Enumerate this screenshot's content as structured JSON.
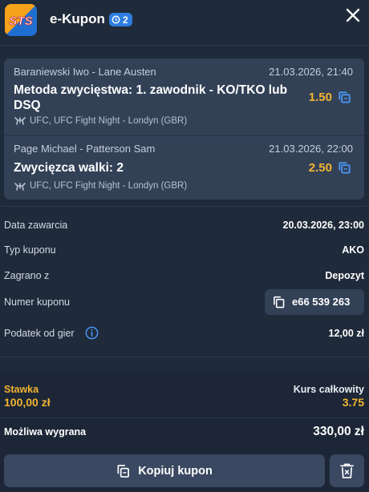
{
  "header": {
    "logo_text": "STS",
    "title": "e-Kupon",
    "badge_count": "2"
  },
  "bets": [
    {
      "match": "Baraniewski Iwo - Lane Austen",
      "date": "21.03.2026, 21:40",
      "market": "Metoda zwycięstwa: 1. zawodnik - KO/TKO lub DSQ",
      "odds": "1.50",
      "league": "UFC, UFC Fight Night - Londyn (GBR)"
    },
    {
      "match": "Page Michael - Patterson Sam",
      "date": "21.03.2026, 22:00",
      "market": "Zwycięzca walki: 2",
      "odds": "2.50",
      "league": "UFC, UFC Fight Night - Londyn (GBR)"
    }
  ],
  "details": {
    "date_label": "Data zawarcia",
    "date_value": "20.03.2026, 23:00",
    "type_label": "Typ kuponu",
    "type_value": "AKO",
    "played_label": "Zagrano z",
    "played_value": "Depozyt",
    "number_label": "Numer kuponu",
    "number_value": "e66 539 263",
    "tax_label": "Podatek od gier",
    "tax_value": "12,00 zł"
  },
  "summary": {
    "stake_label": "Stawka",
    "stake_value": "100,00 zł",
    "total_odds_label": "Kurs całkowity",
    "total_odds_value": "3.75",
    "win_label": "Możliwa wygrana",
    "win_value": "330,00 zł"
  },
  "actions": {
    "copy_label": "Kopiuj kupon"
  },
  "colors": {
    "background": "#1f2a3a",
    "card": "#334157",
    "accent_gold": "#f2b431",
    "accent_blue": "#2f7de0"
  }
}
